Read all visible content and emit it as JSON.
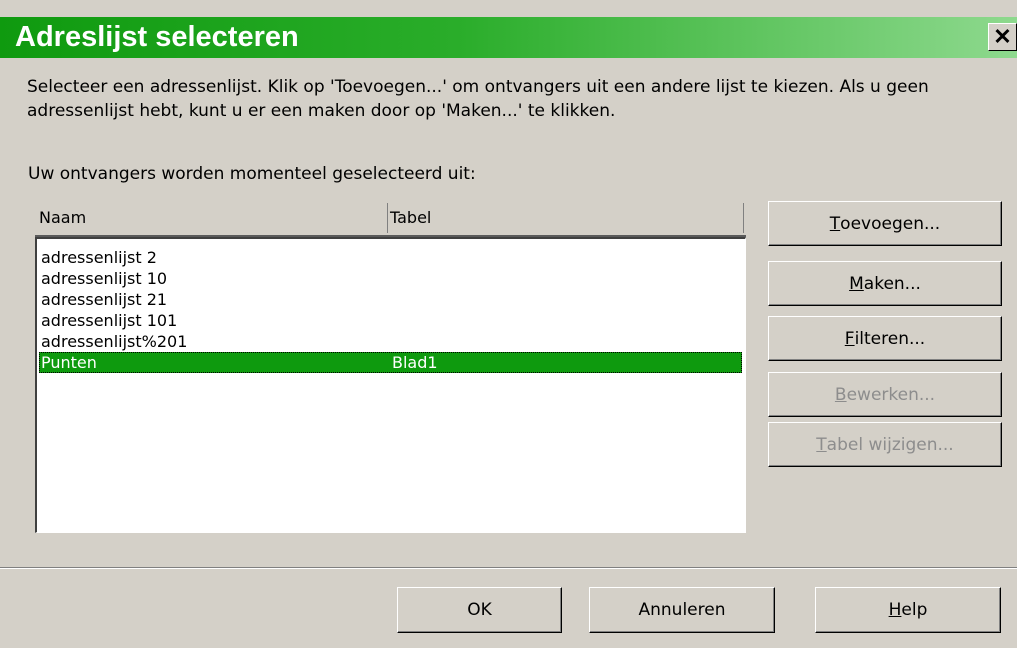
{
  "dialog": {
    "title": "Adreslijst selecteren",
    "close_label": "✕"
  },
  "description": "Selecteer een adressenlijst. Klik op 'Toevoegen...' om ontvangers uit een andere lijst te kiezen. Als u geen adressenlijst hebt, kunt u er een maken door op 'Maken...' te klikken.",
  "current_label": "Uw ontvangers worden momenteel geselecteerd uit:",
  "list": {
    "columns": [
      "Naam",
      "Tabel"
    ],
    "rows": [
      {
        "naam": "adressenlijst 2",
        "tabel": ""
      },
      {
        "naam": "adressenlijst 10",
        "tabel": ""
      },
      {
        "naam": "adressenlijst 21",
        "tabel": ""
      },
      {
        "naam": "adressenlijst 101",
        "tabel": ""
      },
      {
        "naam": "adressenlijst%201",
        "tabel": ""
      },
      {
        "naam": "Punten",
        "tabel": "Blad1",
        "selected": true
      }
    ]
  },
  "side_buttons": {
    "toevoegen": {
      "first": "T",
      "rest": "oevoegen..."
    },
    "maken": {
      "first": "M",
      "rest": "aken..."
    },
    "filteren": {
      "first": "F",
      "rest": "ilteren..."
    },
    "bewerken": {
      "first": "B",
      "rest": "ewerken..."
    },
    "tabel_wijzigen": {
      "first": "T",
      "rest": "abel wijzigen..."
    }
  },
  "footer_buttons": {
    "ok": "OK",
    "annuleren": "Annuleren",
    "help": {
      "first": "H",
      "rest": "elp"
    }
  },
  "colors": {
    "accent": "#0e9a0e",
    "face": "#d4d0c8",
    "disabled_text": "#8d8d8d"
  }
}
